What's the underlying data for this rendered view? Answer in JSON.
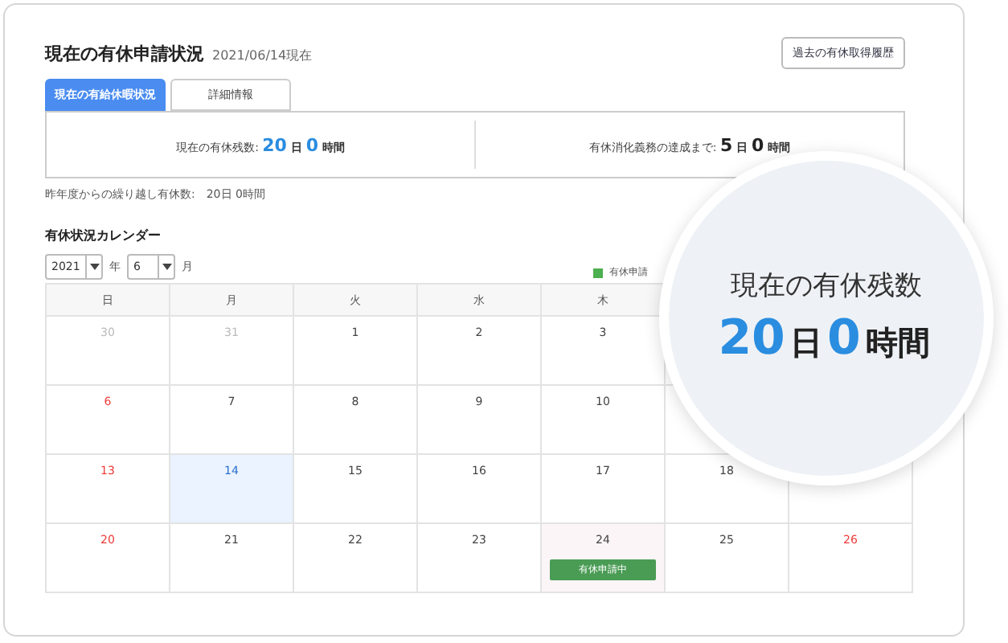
{
  "header": {
    "title": "現在の有休申請状況",
    "as_of": "2021/06/14現在",
    "history_button": "過去の有休取得履歴"
  },
  "tabs": [
    {
      "label": "現在の有給休暇状況",
      "selected": true
    },
    {
      "label": "詳細情報",
      "selected": false
    }
  ],
  "summary": [
    {
      "label": "現在の有休残数:",
      "days": "20",
      "day_unit": "日",
      "hours": "0",
      "hour_unit": "時間",
      "accent": true
    },
    {
      "label": "有休消化義務の達成まで:",
      "days": "5",
      "day_unit": "日",
      "hours": "0",
      "hour_unit": "時間",
      "accent": false
    }
  ],
  "carryover": {
    "label": "昨年度からの繰り越し有休数:",
    "value": "20日 0時間"
  },
  "calendar": {
    "title": "有休状況カレンダー",
    "year": "2021",
    "year_unit": "年",
    "month": "6",
    "month_unit": "月",
    "legend": {
      "label": "有休申請",
      "color": "#4caf50"
    },
    "weekdays": [
      "日",
      "月",
      "火",
      "水",
      "木"
    ],
    "weeks": [
      [
        {
          "day": "30",
          "kind": "other"
        },
        {
          "day": "31",
          "kind": "other"
        },
        {
          "day": "1",
          "kind": "normal"
        },
        {
          "day": "2",
          "kind": "normal"
        },
        {
          "day": "3",
          "kind": "normal"
        }
      ],
      [
        {
          "day": "6",
          "kind": "holiday"
        },
        {
          "day": "7",
          "kind": "normal"
        },
        {
          "day": "8",
          "kind": "normal"
        },
        {
          "day": "9",
          "kind": "normal"
        },
        {
          "day": "10",
          "kind": "normal"
        }
      ],
      [
        {
          "day": "13",
          "kind": "holiday"
        },
        {
          "day": "14",
          "kind": "today"
        },
        {
          "day": "15",
          "kind": "normal"
        },
        {
          "day": "16",
          "kind": "normal"
        },
        {
          "day": "17",
          "kind": "normal"
        },
        {
          "day": "18",
          "kind": "normal"
        }
      ],
      [
        {
          "day": "20",
          "kind": "holiday"
        },
        {
          "day": "21",
          "kind": "normal"
        },
        {
          "day": "22",
          "kind": "normal"
        },
        {
          "day": "23",
          "kind": "normal"
        },
        {
          "day": "24",
          "kind": "applied",
          "badge": "有休申請中"
        },
        {
          "day": "25",
          "kind": "normal"
        },
        {
          "day": "26",
          "kind": "holiday"
        }
      ]
    ]
  },
  "magnifier": {
    "label": "現在の有休残数",
    "days": "20",
    "day_unit": "日",
    "hours": "0",
    "hour_unit": "時間"
  }
}
